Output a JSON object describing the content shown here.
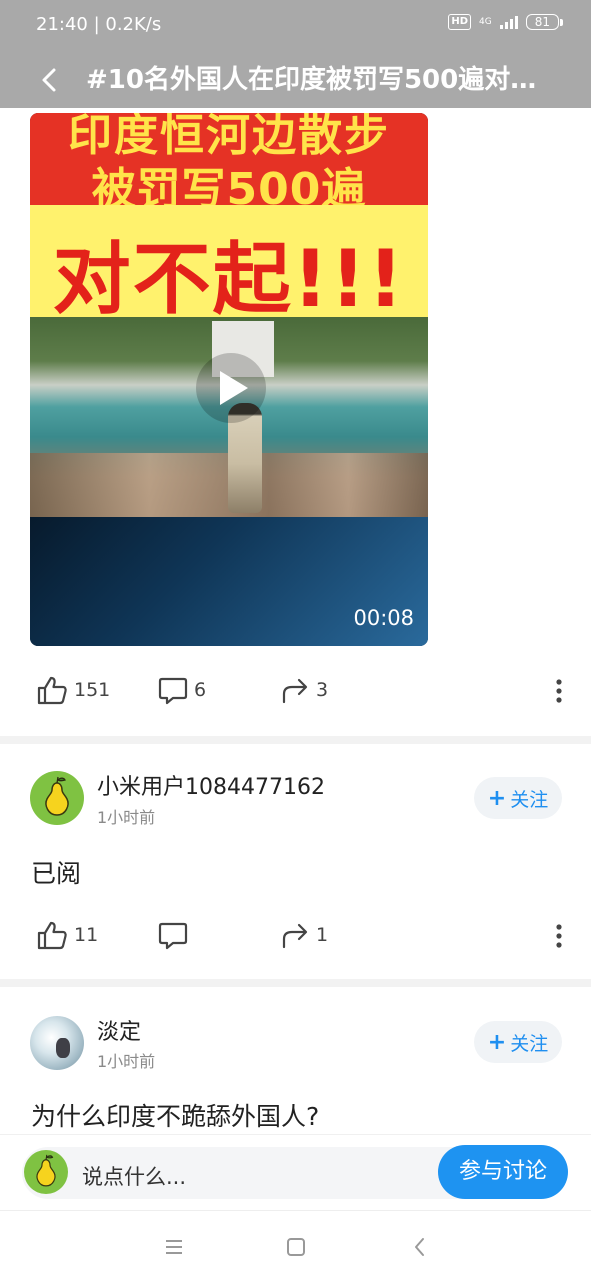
{
  "status_bar": {
    "time_speed": "21:40 | 0.2K/s",
    "hd": "HD",
    "network": "4G",
    "battery": "81"
  },
  "header": {
    "title": "#10名外国人在印度被罚写500遍对…"
  },
  "video": {
    "overlay_line1": "印度恒河边散步",
    "overlay_line2": "被罚写500遍",
    "overlay_big": "对不起!!!",
    "duration": "00:08"
  },
  "post_actions": {
    "likes": "151",
    "comments": "6",
    "shares": "3"
  },
  "comments": [
    {
      "username": "小米用户1084477162",
      "time": "1小时前",
      "follow_label": "关注",
      "text": "已阅",
      "likes": "11",
      "comments": "",
      "shares": "1"
    },
    {
      "username": "淡定",
      "time": "1小时前",
      "follow_label": "关注",
      "text": "为什么印度不跪舔外国人?"
    }
  ],
  "comment_bar": {
    "placeholder": "说点什么...",
    "join_label": "参与讨论"
  }
}
